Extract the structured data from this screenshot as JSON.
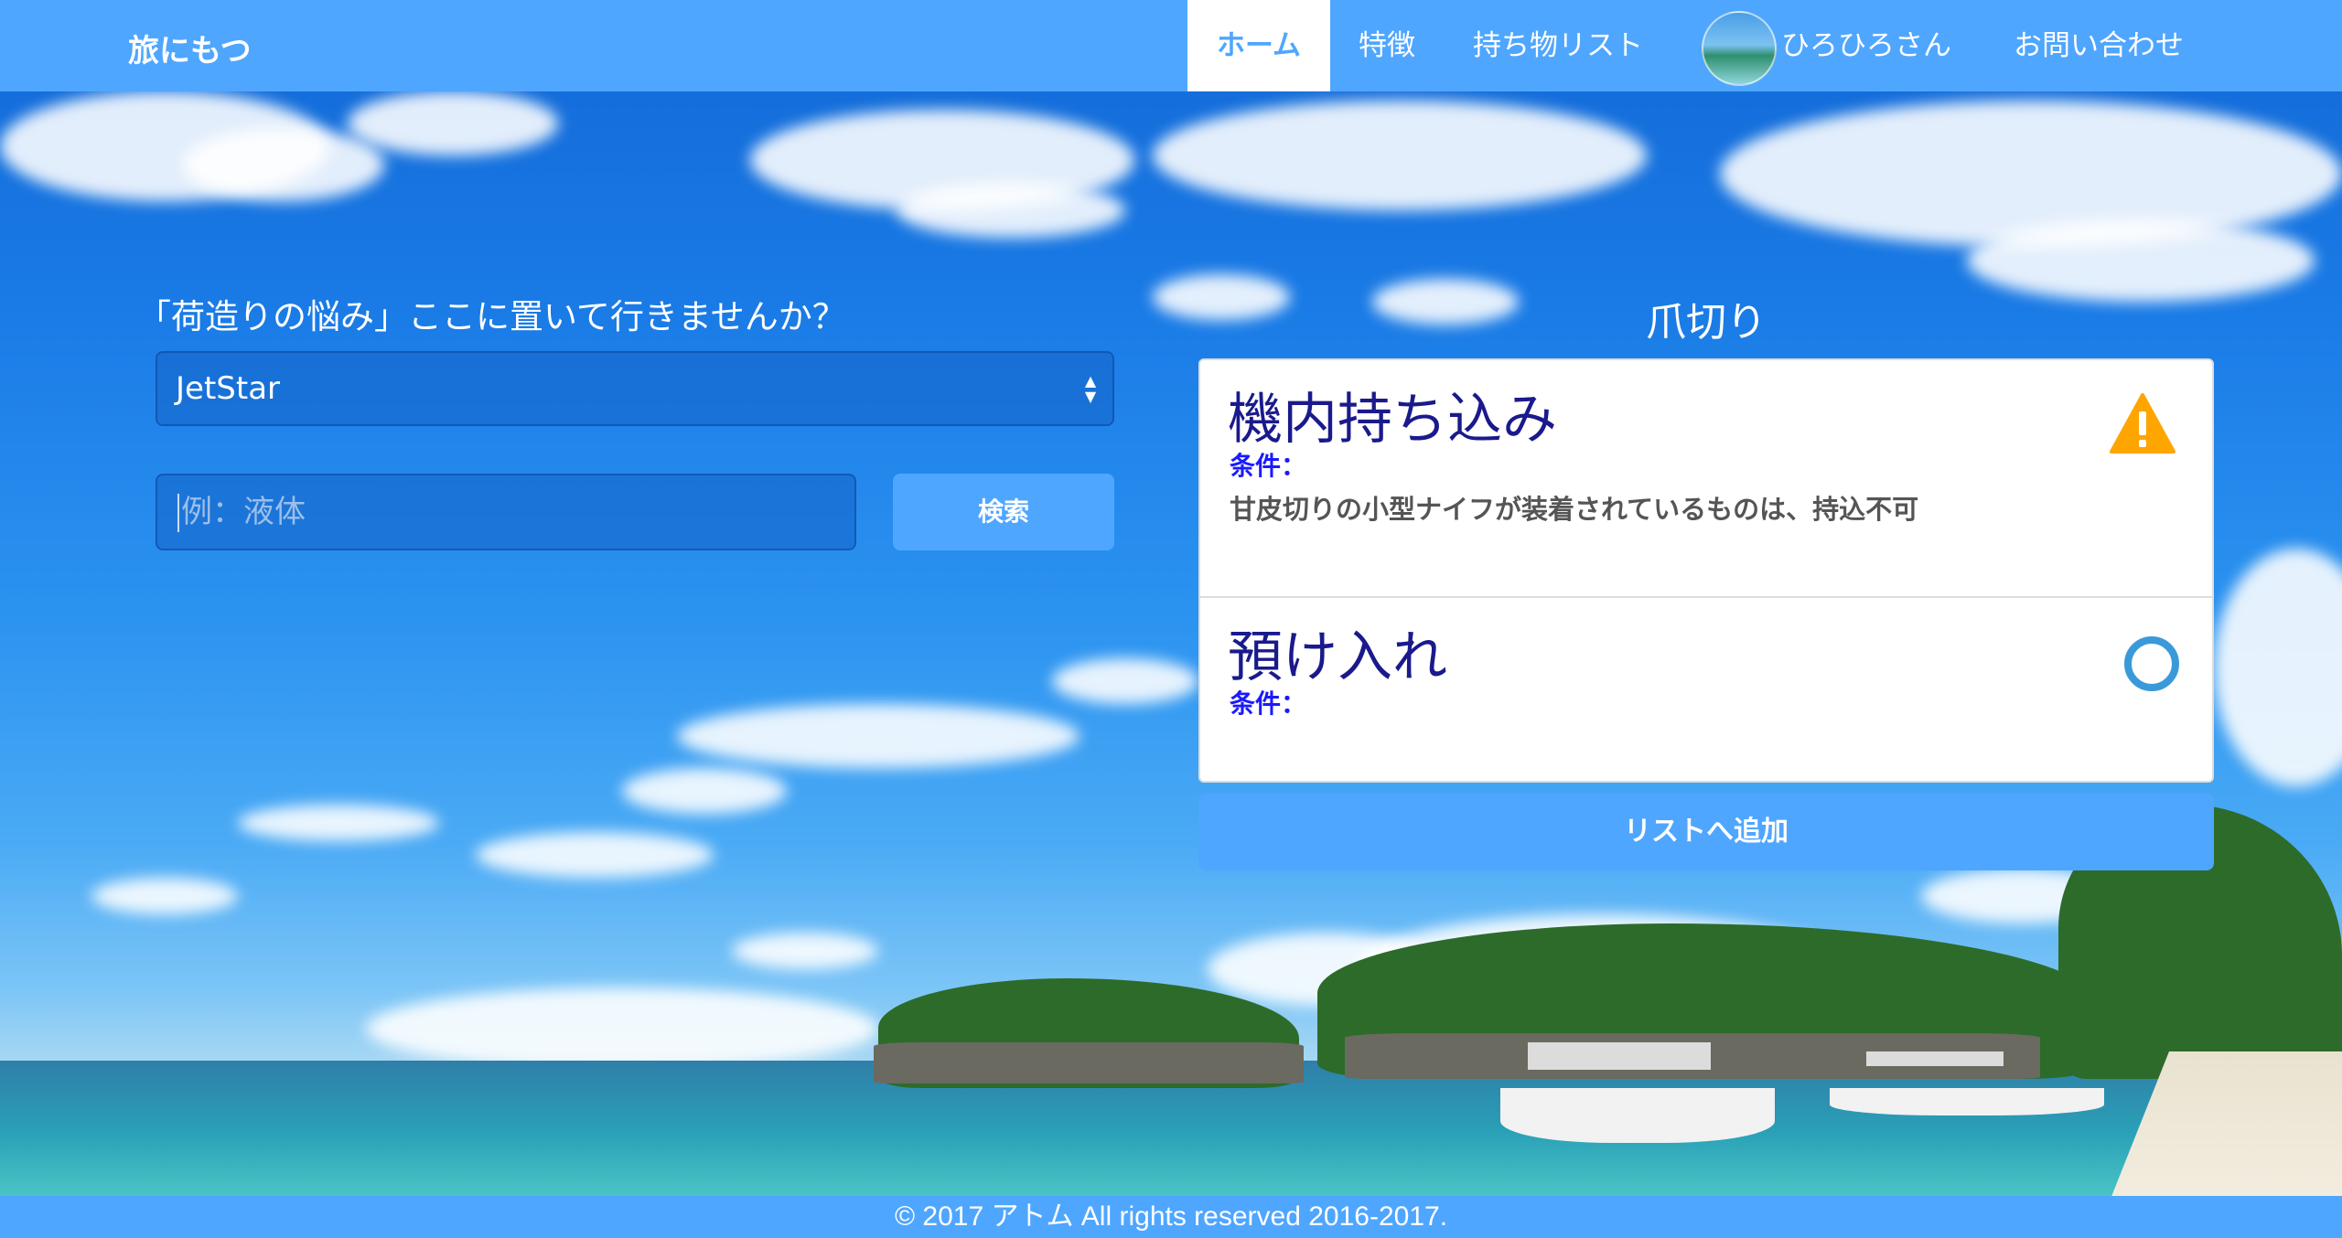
{
  "navbar": {
    "brand": "旅にもつ",
    "items": [
      {
        "label": "ホーム",
        "active": true
      },
      {
        "label": "特徴"
      },
      {
        "label": "持ち物リスト"
      }
    ],
    "user": {
      "name": "ひろひろさん"
    },
    "contact": "お問い合わせ"
  },
  "search": {
    "tagline": "「荷造りの悩み」ここに置いて行きませんか？",
    "airline_selected": "JetStar",
    "placeholder": "例：液体",
    "button_label": "検索"
  },
  "result": {
    "item_name": "爪切り",
    "carry_on": {
      "heading": "機内持ち込み",
      "condition_label": "条件：",
      "note": "甘皮切りの小型ナイフが装着されているものは、持込不可",
      "status_icon": "warning-icon",
      "status_color": "#ffa500"
    },
    "checked": {
      "heading": "預け入れ",
      "condition_label": "条件：",
      "note": "",
      "status_icon": "circle-ok-icon",
      "status_color": "#3a9ad9"
    },
    "add_button_label": "リストへ追加"
  },
  "footer": {
    "text": "© 2017 アトム All rights reserved 2016-2017."
  },
  "colors": {
    "primary": "#4fa6ff",
    "heading": "#1a1a8c",
    "condition": "#1a1aff"
  }
}
